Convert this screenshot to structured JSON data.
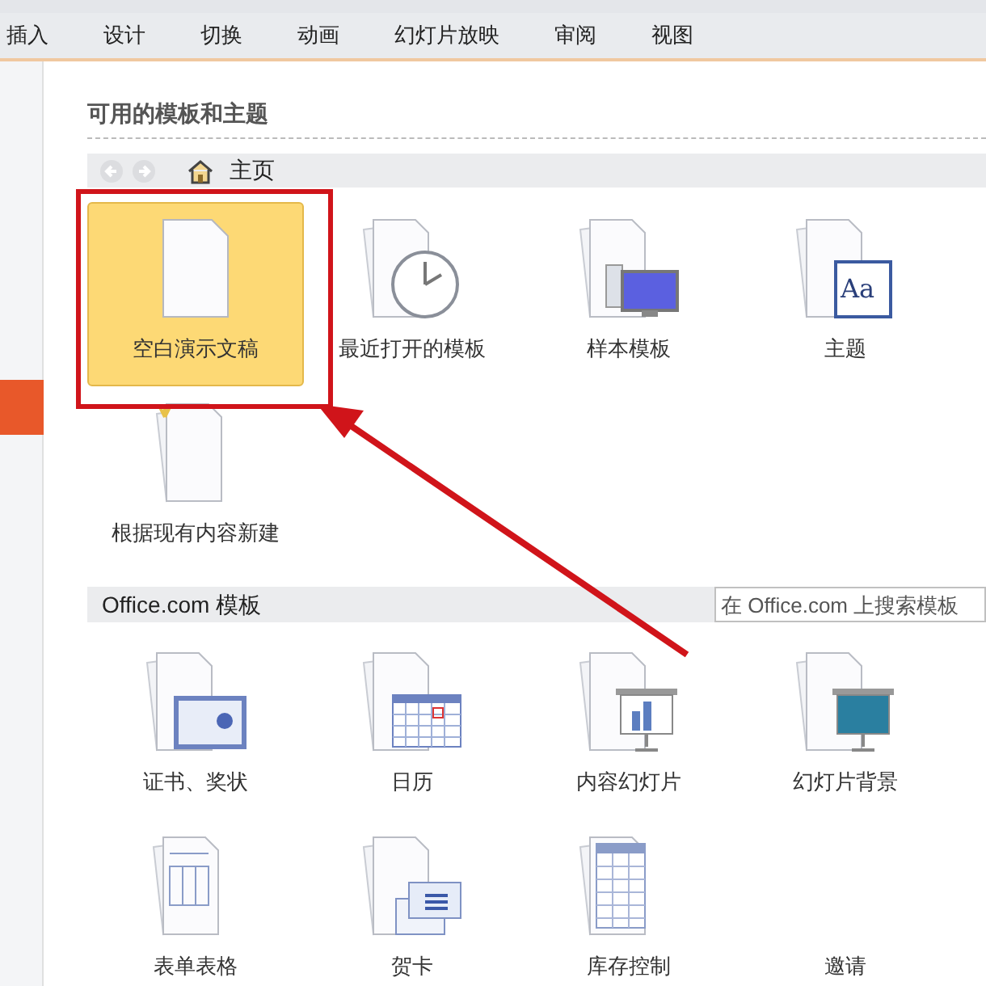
{
  "ribbon_tabs": [
    {
      "label": "插入"
    },
    {
      "label": "设计"
    },
    {
      "label": "切换"
    },
    {
      "label": "动画"
    },
    {
      "label": "幻灯片放映"
    },
    {
      "label": "审阅"
    },
    {
      "label": "视图"
    }
  ],
  "available": {
    "title": "可用的模板和主题",
    "nav": {
      "label": "主页"
    },
    "items": [
      {
        "label": "空白演示文稿",
        "kind": "blank",
        "selected": true
      },
      {
        "label": "最近打开的模板",
        "kind": "recent",
        "selected": false
      },
      {
        "label": "样本模板",
        "kind": "sample",
        "selected": false
      },
      {
        "label": "主题",
        "kind": "theme",
        "icon_text": "Aa",
        "selected": false
      },
      {
        "label": "根据现有内容新建",
        "kind": "existing",
        "selected": false
      }
    ]
  },
  "office_com": {
    "title": "Office.com 模板",
    "search": {
      "placeholder": "在 Office.com 上搜索模板"
    },
    "items": [
      {
        "label": "证书、奖状",
        "kind": "certificate"
      },
      {
        "label": "日历",
        "kind": "calendar"
      },
      {
        "label": "内容幻灯片",
        "kind": "content"
      },
      {
        "label": "幻灯片背景",
        "kind": "background"
      },
      {
        "label": "表单表格",
        "kind": "form"
      },
      {
        "label": "贺卡",
        "kind": "card"
      },
      {
        "label": "库存控制",
        "kind": "inventory"
      },
      {
        "label": "邀请",
        "kind": "invitation"
      }
    ]
  },
  "annotation": {
    "highlight": true
  }
}
